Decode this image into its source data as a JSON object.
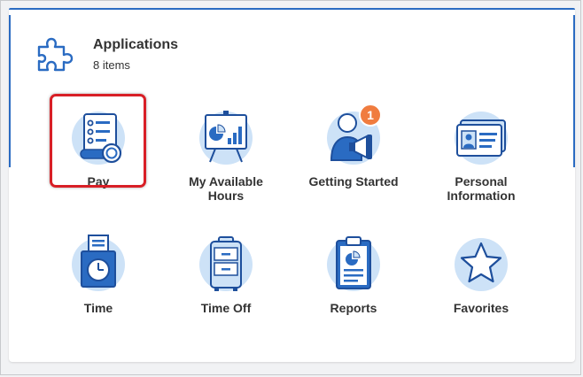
{
  "header": {
    "title": "Applications",
    "count": "8 items",
    "icon": "puzzle-icon"
  },
  "apps": [
    {
      "label": "Pay",
      "icon": "pay-stub-icon",
      "selected": true
    },
    {
      "label": "My Available Hours",
      "icon": "presentation-chart-icon"
    },
    {
      "label": "Getting Started",
      "icon": "person-megaphone-icon",
      "badge": "1"
    },
    {
      "label": "Personal Information",
      "icon": "id-card-icon"
    },
    {
      "label": "Time",
      "icon": "time-clock-icon"
    },
    {
      "label": "Time Off",
      "icon": "suitcase-icon"
    },
    {
      "label": "Reports",
      "icon": "clipboard-report-icon"
    },
    {
      "label": "Favorites",
      "icon": "star-icon"
    }
  ],
  "colors": {
    "accent": "#2a6bc2",
    "icon_bg": "#cde2f7",
    "highlight": "#d81f26",
    "badge": "#f07c3f"
  }
}
